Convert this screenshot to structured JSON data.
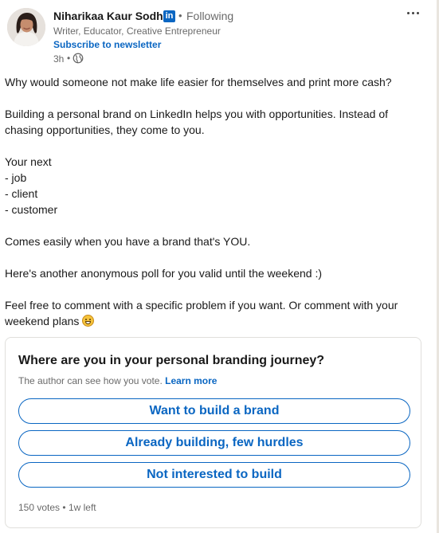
{
  "author": {
    "name": "Niharikaa Kaur Sodhi",
    "badge": "in",
    "separator": "•",
    "follow_status": "Following",
    "headline": "Writer, Educator, Creative Entrepreneur",
    "subscribe_link": "Subscribe to newsletter",
    "time": "3h",
    "time_separator": "•",
    "visibility_icon": "globe-icon"
  },
  "post": {
    "lines": [
      "Why would someone not make life easier for themselves and print more cash?",
      "Building a personal brand on LinkedIn helps you with opportunities. Instead of",
      "chasing opportunities, they come to you.",
      "Your next",
      "- job",
      "- client",
      "- customer",
      "Comes easily when you have a brand that's YOU.",
      "Here's another anonymous poll for you valid until the weekend :)",
      "Feel free to comment with a specific problem if you want. Or comment with your",
      "weekend plans"
    ],
    "emoji": "grinning-face-emoji"
  },
  "poll": {
    "question": "Where are you in your personal branding journey?",
    "note": "The author can see how you vote.",
    "learn_more": "Learn more",
    "options": [
      "Want to build a brand",
      "Already building, few hurdles",
      "Not interested to build"
    ],
    "votes": "150 votes",
    "meta_separator": "•",
    "time_left": "1w left"
  },
  "colors": {
    "accent": "#0a66c2",
    "text": "#000000e6",
    "muted": "#00000099",
    "border": "#e0dfdc"
  }
}
